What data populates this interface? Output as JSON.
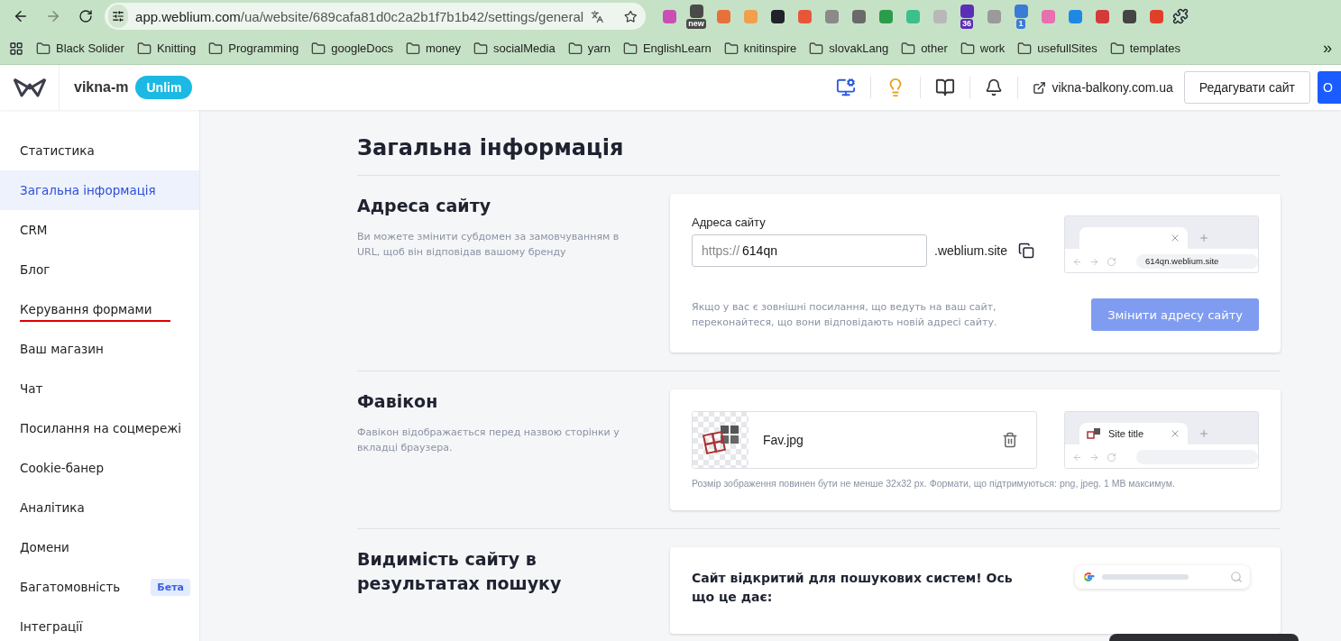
{
  "browser": {
    "address": {
      "host": "app.weblium.com",
      "path": "/ua/website/689cafa81d0c2a2b1f7b1b42/settings/general"
    },
    "extensions": [
      {
        "color": "#c94fb5"
      },
      {
        "color": "#4a4a4a",
        "badge": "new"
      },
      {
        "color": "#e8703a"
      },
      {
        "color": "#f0a04b"
      },
      {
        "color": "#20232a"
      },
      {
        "color": "#e8563a"
      },
      {
        "color": "#8a8a8a"
      },
      {
        "color": "#6a6a6a"
      },
      {
        "color": "#2a9d4a"
      },
      {
        "color": "#3cc08a"
      },
      {
        "color": "#b8b8b8"
      },
      {
        "color": "#5b2fb5",
        "badge": "36"
      },
      {
        "color": "#9a9a9a"
      },
      {
        "color": "#3a7bd5",
        "badge": "1"
      },
      {
        "color": "#e86fb0"
      },
      {
        "color": "#1e88e5"
      },
      {
        "color": "#d33a3a"
      },
      {
        "color": "#444444"
      },
      {
        "color": "#e0402a"
      }
    ],
    "bookmarks": [
      "Black Solider",
      "Knitting",
      "Programming",
      "googleDocs",
      "money",
      "socialMedia",
      "yarn",
      "EnglishLearn",
      "knitinspire",
      "slovakLang",
      "other",
      "work",
      "usefullSites",
      "templates"
    ],
    "more": "»"
  },
  "header": {
    "site_name": "vikna-m",
    "plan": "Unlim",
    "domain_link": "vikna-balkony.com.ua",
    "edit_button": "Редагувати сайт",
    "publish_button": "О"
  },
  "sidebar": {
    "items": [
      {
        "label": "Статистика",
        "selected": false,
        "underlined": false
      },
      {
        "label": "Загальна інформація",
        "selected": true,
        "underlined": false
      },
      {
        "label": "CRM",
        "selected": false,
        "underlined": false
      },
      {
        "label": "Блог",
        "selected": false,
        "underlined": false
      },
      {
        "label": "Керування формами",
        "selected": false,
        "underlined": true
      },
      {
        "label": "Ваш магазин",
        "selected": false,
        "underlined": false
      },
      {
        "label": "Чат",
        "selected": false,
        "underlined": false
      },
      {
        "label": "Посилання на соцмережі",
        "selected": false,
        "underlined": false
      },
      {
        "label": "Cookie-банер",
        "selected": false,
        "underlined": false
      },
      {
        "label": "Аналітика",
        "selected": false,
        "underlined": false
      },
      {
        "label": "Домени",
        "selected": false,
        "underlined": false
      },
      {
        "label": "Багатомовність",
        "selected": false,
        "underlined": false,
        "badge": "Бета"
      },
      {
        "label": "Інтеграції",
        "selected": false,
        "underlined": false
      }
    ]
  },
  "page": {
    "title": "Загальна інформація",
    "sections": [
      {
        "kind": "address",
        "title": "Адреса сайту",
        "description": "Ви можете змінити субдомен за замовчуванням в URL, щоб він відповідав вашому бренду",
        "field_label": "Адреса сайту",
        "prefix": "https://",
        "value": "614qn",
        "suffix": ".weblium.site",
        "preview_url": "614qn.weblium.site",
        "note": "Якщо у вас є зовнішні посилання, що ведуть на ваш сайт, переконайтеся, що вони відповідають новій адресі сайту.",
        "button": {
          "label": "Змінити адресу сайту",
          "disabled": true
        }
      },
      {
        "kind": "favicon",
        "title": "Фавікон",
        "description": "Фавікон відображається перед назвою сторінки у вкладці браузера.",
        "file_name": "Fav.jpg",
        "preview_title": "Site title",
        "hint": "Розмір зображення повинен бути не менше 32x32 px. Формати, що підтримуються: png, jpeg. 1 MB максимум."
      },
      {
        "kind": "visibility",
        "title": "Видимість сайту в результатах пошуку",
        "heading": "Сайт відкритий для пошукових систем! Ось що це дає:"
      }
    ]
  }
}
